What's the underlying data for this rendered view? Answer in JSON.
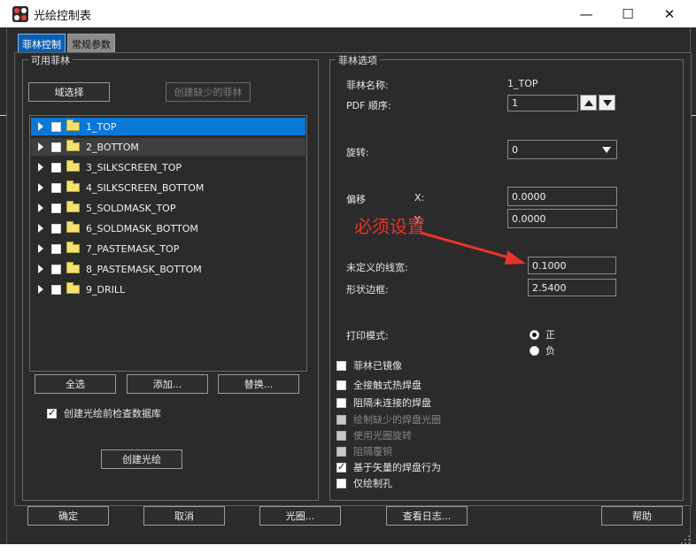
{
  "window": {
    "title": "光绘控制表",
    "minimize_glyph": "—",
    "maximize_glyph": "☐",
    "close_glyph": "✕"
  },
  "tabs": [
    {
      "label": "菲林控制",
      "active": true
    },
    {
      "label": "常规参数",
      "active": false
    }
  ],
  "left_panel": {
    "title": "可用菲林",
    "region_select_label": "域选择",
    "create_missing_label": "创建缺少的菲林",
    "films": [
      {
        "label": "1_TOP",
        "selected": true
      },
      {
        "label": "2_BOTTOM",
        "hover": true
      },
      {
        "label": "3_SILKSCREEN_TOP"
      },
      {
        "label": "4_SILKSCREEN_BOTTOM"
      },
      {
        "label": "5_SOLDMASK_TOP"
      },
      {
        "label": "6_SOLDMASK_BOTTOM"
      },
      {
        "label": "7_PASTEMASK_TOP"
      },
      {
        "label": "8_PASTEMASK_BOTTOM"
      },
      {
        "label": "9_DRILL"
      }
    ],
    "select_all_label": "全选",
    "add_label": "添加...",
    "replace_label": "替换...",
    "check_db_label": "创建光绘前检查数据库",
    "check_db_checked": true,
    "create_artwork_label": "创建光绘"
  },
  "right_panel": {
    "title": "菲林选项",
    "film_name_label": "菲林名称:",
    "film_name_value": "1_TOP",
    "pdf_order_label": "PDF 顺序:",
    "pdf_order_value": "1",
    "rotation_label": "旋转:",
    "rotation_value": "0",
    "offset_label": "偏移",
    "offset_x_label": "X:",
    "offset_x_value": "0.0000",
    "offset_y_label": "Y:",
    "offset_y_value": "0.0000",
    "undefined_line_width_label": "未定义的线宽:",
    "undefined_line_width_value": "0.1000",
    "shape_bounding_label": "形状边框:",
    "shape_bounding_value": "2.5400",
    "plot_mode_label": "打印模式:",
    "plot_mode_positive": "正",
    "plot_mode_negative": "负",
    "plot_mode_selected": "positive",
    "options": [
      {
        "label": "菲林已镜像",
        "checked": false,
        "disabled": false
      },
      {
        "label": "全接触式热焊盘",
        "checked": false,
        "disabled": false
      },
      {
        "label": "阻隔未连接的焊盘",
        "checked": false,
        "disabled": false
      },
      {
        "label": "绘制缺少的焊盘光圈",
        "checked": false,
        "disabled": true
      },
      {
        "label": "使用光圈旋转",
        "checked": false,
        "disabled": true
      },
      {
        "label": "阻隔覆铜",
        "checked": false,
        "disabled": true
      },
      {
        "label": "基于矢量的焊盘行为",
        "checked": true,
        "disabled": false
      },
      {
        "label": "仅绘制孔",
        "checked": false,
        "disabled": false
      }
    ]
  },
  "annotation_text": "必须设置",
  "colors": {
    "accent": "#0a78d7",
    "annotation": "#e8332a",
    "folder": "#f4e26f"
  },
  "footer": {
    "ok_label": "确定",
    "cancel_label": "取消",
    "aperture_label": "光圈...",
    "view_log_label": "查看日志...",
    "help_label": "帮助"
  }
}
